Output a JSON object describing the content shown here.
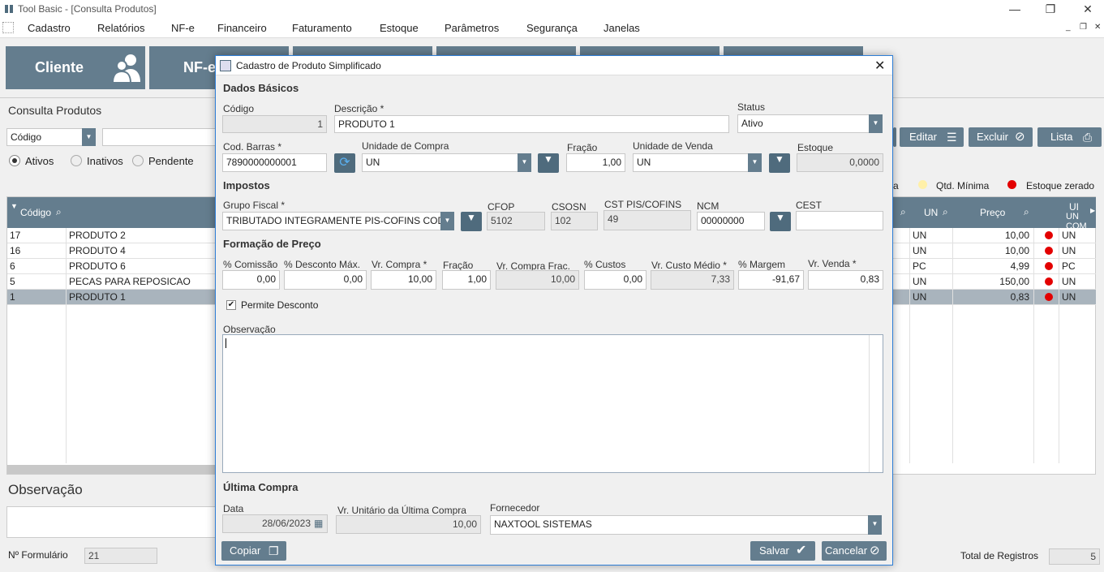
{
  "window": {
    "title": "Tool Basic - [Consulta Produtos]"
  },
  "menu": [
    "Cadastro",
    "Relatórios",
    "NF-e",
    "Financeiro",
    "Faturamento",
    "Estoque",
    "Parâmetros",
    "Segurança",
    "Janelas"
  ],
  "toolbar": {
    "cliente": "Cliente",
    "nfe": "NF-e"
  },
  "consulta": {
    "title": "Consulta Produtos",
    "search_field": "Código",
    "filters": [
      "Ativos",
      "Inativos",
      "Pendente"
    ],
    "buttons": {
      "editar": "Editar",
      "excluir": "Excluir",
      "lista": "Lista"
    },
    "legend": {
      "partial": "a",
      "qtd_minima": "Qtd. Mínima",
      "estoque_zerado": "Estoque zerado"
    },
    "columns": {
      "codigo": "Código",
      "un": "UN",
      "preco": "Preço",
      "un_com": "UN COM",
      "ui": "UI"
    },
    "rows": [
      {
        "codigo": "17",
        "descricao": "PRODUTO 2",
        "un": "UN",
        "preco": "10,00",
        "un2": "UN"
      },
      {
        "codigo": "16",
        "descricao": "PRODUTO 4",
        "un": "UN",
        "preco": "10,00",
        "un2": "UN"
      },
      {
        "codigo": "6",
        "descricao": "PRODUTO 6",
        "un": "PC",
        "preco": "4,99",
        "un2": "PC"
      },
      {
        "codigo": "5",
        "descricao": "PECAS PARA REPOSICAO",
        "un": "UN",
        "preco": "150,00",
        "un2": "UN"
      },
      {
        "codigo": "1",
        "descricao": "PRODUTO 1",
        "un": "UN",
        "preco": "0,83",
        "un2": "UN"
      }
    ],
    "observacao_label": "Observação",
    "formulario_label": "Nº Formulário",
    "formulario_value": "21",
    "total_label": "Total de Registros",
    "total_value": "5"
  },
  "dialog": {
    "title": "Cadastro de Produto Simplificado",
    "sec_dados": "Dados Básicos",
    "codigo_label": "Código",
    "codigo": "1",
    "descricao_label": "Descrição *",
    "descricao": "PRODUTO 1",
    "status_label": "Status",
    "status": "Ativo",
    "barras_label": "Cod. Barras *",
    "barras": "7890000000001",
    "uc_label": "Unidade de Compra",
    "uc": "UN",
    "fracao_label": "Fração",
    "fracao": "1,00",
    "uv_label": "Unidade de  Venda",
    "uv": "UN",
    "estoque_label": "Estoque",
    "estoque": "0,0000",
    "sec_impostos": "Impostos",
    "grupo_label": "Grupo Fiscal *",
    "grupo": "TRIBUTADO INTEGRAMENTE PIS-COFINS COD",
    "cfop_label": "CFOP",
    "cfop": "5102",
    "csosn_label": "CSOSN",
    "csosn": "102",
    "cst_label": "CST PIS/COFINS",
    "cst": "49",
    "ncm_label": "NCM",
    "ncm": "00000000",
    "cest_label": "CEST",
    "cest": "",
    "sec_preco": "Formação de Preço",
    "comissao_label": "% Comissão",
    "comissao": "0,00",
    "desconto_label": "% Desconto Máx.",
    "desconto": "0,00",
    "vrcompra_label": "Vr. Compra *",
    "vrcompra": "10,00",
    "fracao2_label": "Fração",
    "fracao2": "1,00",
    "vrfrac_label": "Vr. Compra Frac.",
    "vrfrac": "10,00",
    "custos_label": "% Custos",
    "custos": "0,00",
    "custo_medio_label": "Vr. Custo Médio *",
    "custo_medio": "7,33",
    "margem_label": "% Margem",
    "margem": "-91,67",
    "venda_label": "Vr. Venda *",
    "venda": "0,83",
    "permite_label": "Permite Desconto",
    "obs_label": "Observação",
    "sec_ultima": "Última Compra",
    "data_label": "Data",
    "data": "28/06/2023",
    "vrunit_label": "Vr. Unitário da Última Compra",
    "vrunit": "10,00",
    "fornecedor_label": "Fornecedor",
    "fornecedor": "NAXTOOL SISTEMAS",
    "copiar": "Copiar",
    "salvar": "Salvar",
    "cancelar": "Cancelar"
  }
}
